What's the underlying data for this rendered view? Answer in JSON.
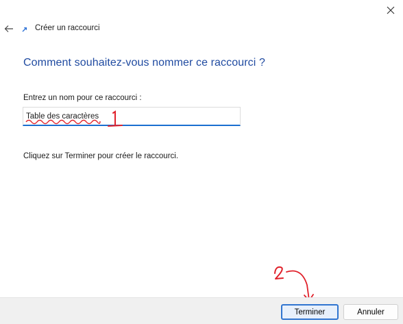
{
  "wizard": {
    "title": "Créer un raccourci",
    "heading": "Comment souhaitez-vous nommer ce raccourci ?",
    "name_label": "Entrez un nom pour ce raccourci :",
    "name_value": "Table des caractères",
    "hint": "Cliquez sur Terminer pour créer le raccourci."
  },
  "buttons": {
    "finish": "Terminer",
    "cancel": "Annuler"
  },
  "annotations": {
    "step1": "1",
    "step2": "2",
    "color": "#e0202a"
  },
  "colors": {
    "heading": "#1f4aa0",
    "accent": "#2f74d0",
    "footer": "#f0f0f0"
  },
  "icons": [
    "close-icon",
    "back-arrow-icon",
    "shortcut-arrow-icon"
  ]
}
